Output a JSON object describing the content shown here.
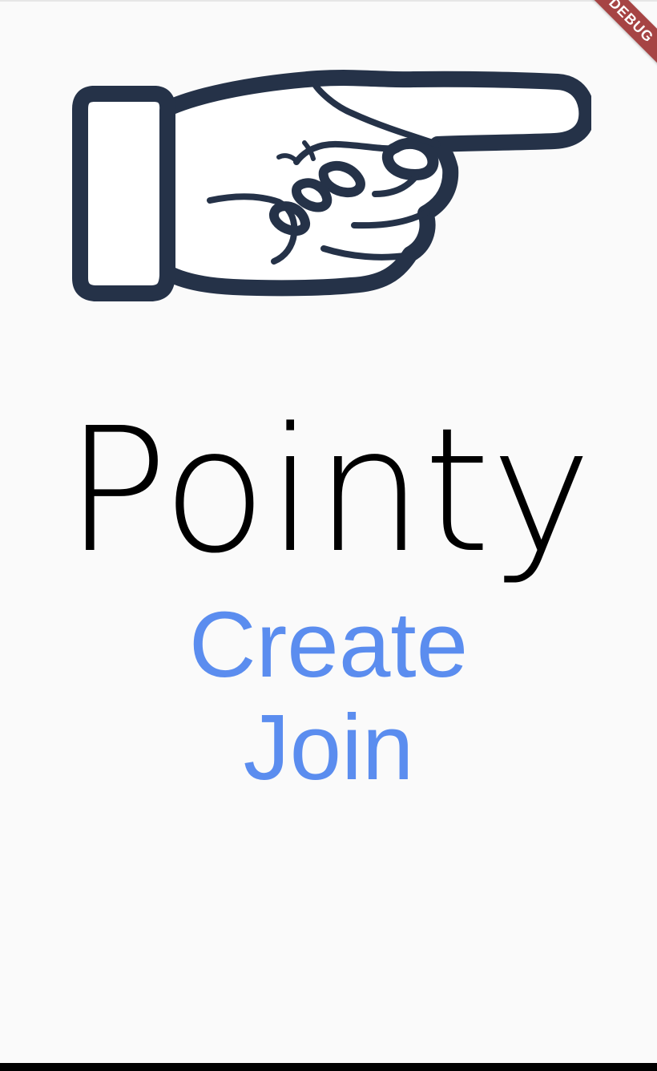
{
  "app": {
    "title": "Pointy",
    "accent_color": "#5b8def",
    "text_color": "#000000",
    "background_color": "#fafafa"
  },
  "logo": {
    "icon": "pointing-hand-icon",
    "fill_color": "#ffffff",
    "outline_color": "#253248"
  },
  "actions": {
    "create_label": "Create",
    "join_label": "Join"
  },
  "debug_banner": {
    "label": "DEBUG",
    "color": "#a64444"
  }
}
